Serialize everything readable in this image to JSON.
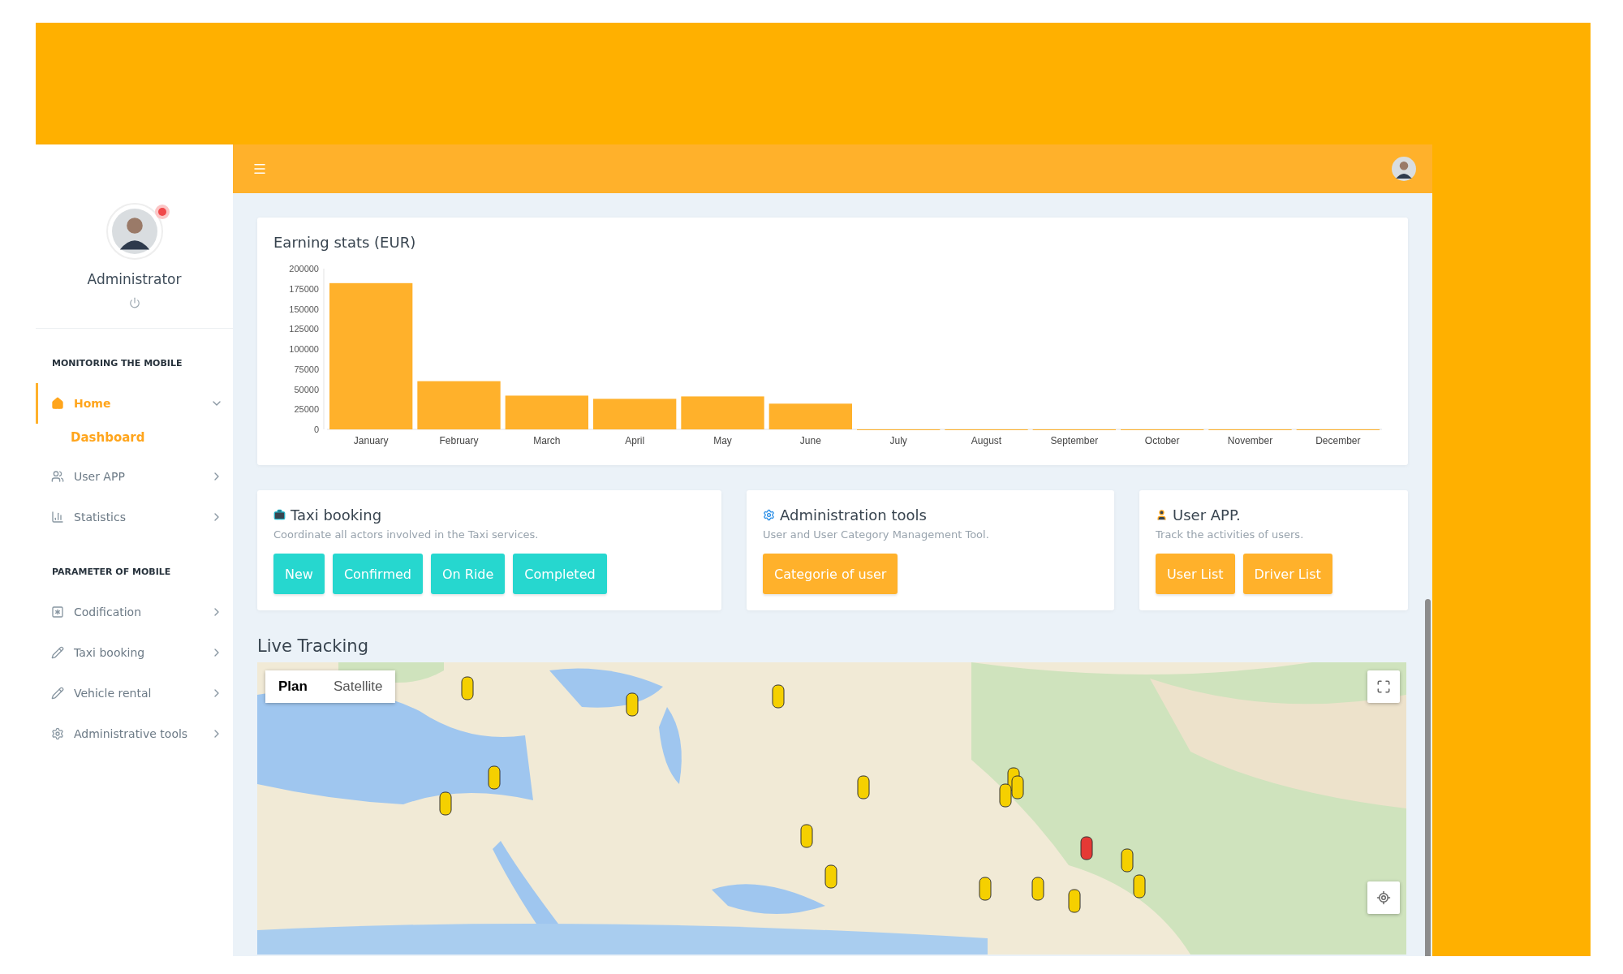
{
  "sidebar": {
    "user": {
      "name": "Administrator",
      "online": true
    },
    "sections": [
      {
        "title": "MONITORING THE MOBILE",
        "items": [
          {
            "label": "Home",
            "kind": "home",
            "selected": true,
            "expanded": true,
            "children": [
              {
                "label": "Dashboard",
                "selected": true
              }
            ]
          },
          {
            "label": "User APP",
            "kind": "users",
            "selected": false,
            "expanded": false
          },
          {
            "label": "Statistics",
            "kind": "chart",
            "selected": false,
            "expanded": false
          }
        ]
      },
      {
        "title": "PARAMETER OF MOBILE",
        "items": [
          {
            "label": "Codification",
            "kind": "box",
            "selected": false,
            "expanded": false
          },
          {
            "label": "Taxi booking",
            "kind": "pencil",
            "selected": false,
            "expanded": false
          },
          {
            "label": "Vehicle rental",
            "kind": "pencil",
            "selected": false,
            "expanded": false
          },
          {
            "label": "Administrative tools",
            "kind": "gear",
            "selected": false,
            "expanded": false
          }
        ]
      }
    ]
  },
  "earning_stats": {
    "title": "Earning stats (EUR)",
    "chart_data": {
      "type": "bar",
      "categories": [
        "January",
        "February",
        "March",
        "April",
        "May",
        "June",
        "July",
        "August",
        "September",
        "October",
        "November",
        "December"
      ],
      "series": [
        {
          "color": "#ffb12b",
          "values": [
            182000,
            60000,
            42000,
            38000,
            41000,
            32000,
            0,
            0,
            0,
            0,
            0,
            0
          ]
        }
      ],
      "ylim": [
        0,
        200000
      ],
      "yticks": [
        0,
        25000,
        50000,
        75000,
        100000,
        125000,
        150000,
        175000,
        200000
      ]
    }
  },
  "cards": [
    {
      "kind": "briefcase",
      "title": "Taxi booking",
      "description": "Coordinate all actors involved in the Taxi services.",
      "buttons": [
        "New",
        "Confirmed",
        "On Ride",
        "Completed"
      ]
    },
    {
      "kind": "gear",
      "title": "Administration tools",
      "description": "User and User Category Management Tool.",
      "buttons": [
        "Categorie of user"
      ]
    },
    {
      "kind": "user",
      "title": "User APP.",
      "description": "Track the activities of users.",
      "buttons": [
        "User List",
        "Driver List"
      ]
    }
  ],
  "live_tracking": {
    "title": "Live Tracking",
    "map": {
      "kind": "picture",
      "view_buttons": [
        {
          "label": "Plan",
          "selected": true
        },
        {
          "label": "Satellite",
          "selected": false
        }
      ]
    }
  }
}
